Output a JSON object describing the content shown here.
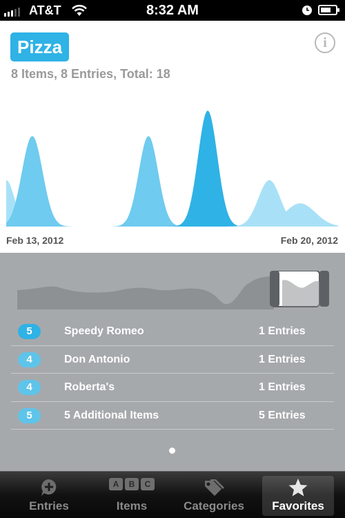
{
  "status_bar": {
    "carrier": "AT&T",
    "time": "8:32 AM"
  },
  "header": {
    "title": "Pizza",
    "subtitle": "8 Items, 8 Entries, Total: 18"
  },
  "chart_data": {
    "type": "area",
    "x_start_label": "Feb 13, 2012",
    "x_end_label": "Feb 20, 2012",
    "peaks": [
      {
        "day": 0.0,
        "height": 0.4
      },
      {
        "day": 0.55,
        "height": 0.78
      },
      {
        "day": 3.0,
        "height": 0.78
      },
      {
        "day": 4.25,
        "height": 1.0
      },
      {
        "day": 5.55,
        "height": 0.4
      },
      {
        "day": 6.2,
        "height": 0.2
      }
    ],
    "colors": {
      "light": "#a8e1f7",
      "medium": "#6fcbef",
      "strong": "#2fb2e5"
    }
  },
  "entries": [
    {
      "count": "5",
      "name": "Speedy Romeo",
      "meta": "1 Entries"
    },
    {
      "count": "4",
      "name": "Don Antonio",
      "meta": "1 Entries"
    },
    {
      "count": "4",
      "name": "Roberta's",
      "meta": "1 Entries"
    },
    {
      "count": "5",
      "name": "5 Additional Items",
      "meta": "5 Entries"
    }
  ],
  "tabs": [
    {
      "label": "Entries",
      "icon": "add-entry-icon"
    },
    {
      "label": "Items",
      "icon": "abc-icon",
      "letters": [
        "A",
        "B",
        "C"
      ]
    },
    {
      "label": "Categories",
      "icon": "tags-icon"
    },
    {
      "label": "Favorites",
      "icon": "star-icon",
      "active": true
    }
  ]
}
